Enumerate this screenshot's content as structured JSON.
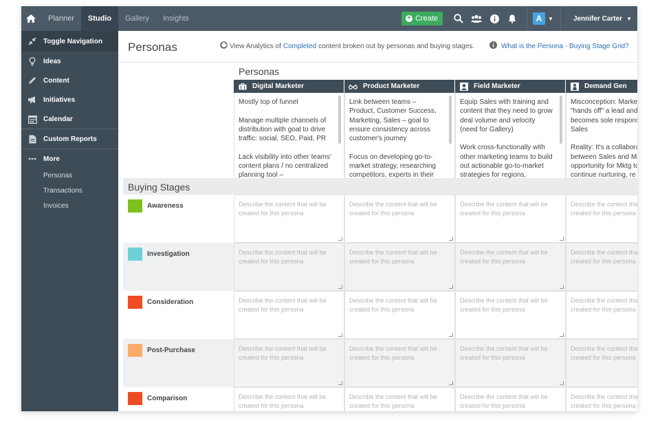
{
  "topbar": {
    "tabs": [
      {
        "label": "Planner",
        "active": false
      },
      {
        "label": "Studio",
        "active": true
      },
      {
        "label": "Gallery",
        "active": false
      },
      {
        "label": "Insights",
        "active": false
      }
    ],
    "create_label": "Create",
    "avatar_letter": "A",
    "user_name": "Jennifer Carter",
    "icons": [
      "home-icon",
      "search-icon",
      "users-icon",
      "info-icon",
      "bell-icon"
    ]
  },
  "sidebar": {
    "items": [
      {
        "label": "Toggle Navigation",
        "icon": "compress-icon"
      },
      {
        "label": "Ideas",
        "icon": "lightbulb-icon"
      },
      {
        "label": "Content",
        "icon": "pencil-icon"
      },
      {
        "label": "Initiatives",
        "icon": "megaphone-icon"
      },
      {
        "label": "Calendar",
        "icon": "calendar-icon"
      },
      {
        "label": "Custom Reports",
        "icon": "report-icon"
      },
      {
        "label": "More",
        "icon": "ellipsis-icon"
      }
    ],
    "sub_items": [
      "Personas",
      "Transactions",
      "Invoices"
    ]
  },
  "header": {
    "title": "Personas",
    "analytics_pre": "View Analytics of",
    "analytics_link": "Completed",
    "analytics_post": "content broken out by personas and buying stages.",
    "help_link": "What is the Persona - Buying Stage Grid?"
  },
  "grid": {
    "personas_title": "Personas",
    "buying_title": "Buying Stages",
    "placeholder": "Describe the content that will be created for this persona",
    "personas": [
      {
        "name": "Digital Marketer",
        "icon": "briefcase-icon",
        "desc": "Mostly top of funnel\n\nManage multiple channels of distribution with goal to drive traffic: social, SEO, Paid, PR\n\nLack visibility into other teams' content plans / no centralized planning tool –"
      },
      {
        "name": "Product Marketer",
        "icon": "glasses-icon",
        "desc": "Link between teams – Product, Customer Success, Marketing, Sales – goal to ensure consistency across customer's journey\n\nFocus on developing go-to-market strategy, researching competitors, experts in their"
      },
      {
        "name": "Field Marketer",
        "icon": "user-icon",
        "desc": "Equip Sales with training and content that they need to grow deal volume and velocity (need for Gallery)\n\nWork cross-functionally with other marketing teams to build out actionable go-to-market strategies for regions,"
      },
      {
        "name": "Demand Gen",
        "icon": "person-icon",
        "desc": "Misconception: Marketing \"hands off\" a lead and Sales becomes sole responsible of Sales\n\nReality: It's a collaboration between Sales and Marketing opportunity for Mktg to continue nurturing, re"
      }
    ],
    "stages": [
      {
        "label": "Awareness",
        "color": "#7dc11f"
      },
      {
        "label": "Investigation",
        "color": "#6dd0d7"
      },
      {
        "label": "Consideration",
        "color": "#ee4d24"
      },
      {
        "label": "Post-Purchase",
        "color": "#fcac6a"
      },
      {
        "label": "Comparison",
        "color": "#ee4d24"
      }
    ]
  }
}
